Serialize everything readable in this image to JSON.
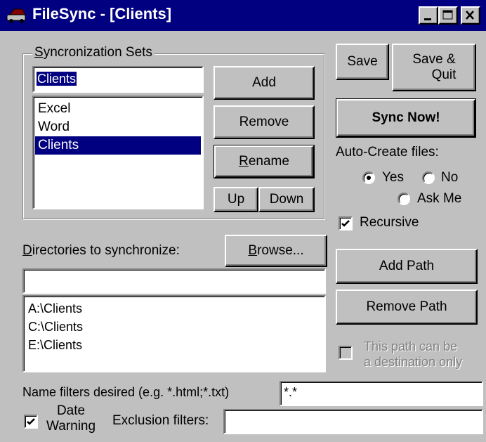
{
  "window": {
    "title": "FileSync - [Clients]"
  },
  "sync_sets": {
    "group_label_prefix": "S",
    "group_label_rest": "yncronization Sets",
    "name_input_value": "Clients",
    "items": [
      "Excel",
      "Word",
      "Clients"
    ],
    "selected_index": 2,
    "add_label": "Add",
    "remove_label": "Remove",
    "rename_prefix": "R",
    "rename_rest": "ename",
    "up_label": "Up",
    "down_label": "Down"
  },
  "actions": {
    "save_label": "Save",
    "save_quit_line1": "Save &",
    "save_quit_line2": "Quit",
    "sync_now_label": "Sync Now!"
  },
  "auto_create": {
    "label": "Auto-Create files:",
    "options": [
      "Yes",
      "No",
      "Ask Me"
    ],
    "selected": "Yes",
    "recursive_label": "Recursive",
    "recursive_checked": true
  },
  "directories": {
    "label_prefix": "D",
    "label_rest": "irectories to synchronize:",
    "browse_prefix": "B",
    "browse_rest": "rowse...",
    "path_input_value": "",
    "items": [
      "A:\\Clients",
      "C:\\Clients",
      "E:\\Clients"
    ],
    "add_path_label": "Add Path",
    "remove_path_label": "Remove Path",
    "dest_only_line1": "This path can be",
    "dest_only_line2": "a destination only",
    "dest_only_checked": false
  },
  "filters": {
    "name_filters_label": "Name filters desired (e.g. *.html;*.txt)",
    "name_filters_value": "*.*",
    "date_warning_line1": "Date",
    "date_warning_line2": "Warning",
    "date_warning_checked": true,
    "exclusion_label": "Exclusion filters:",
    "exclusion_value": ""
  }
}
